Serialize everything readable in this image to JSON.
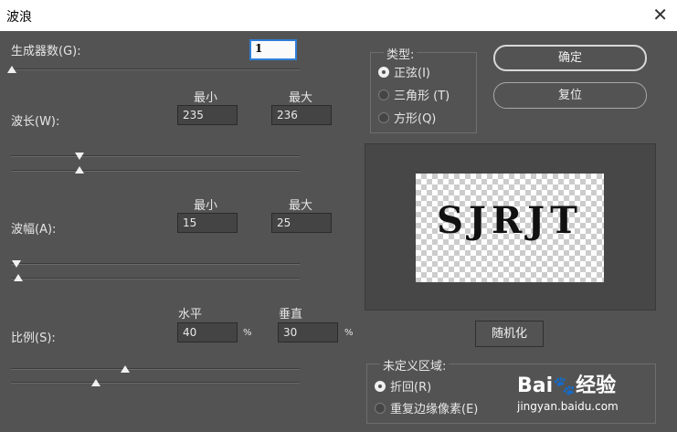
{
  "window": {
    "title": "波浪"
  },
  "generators": {
    "label": "生成器数(G):",
    "value": "1",
    "min": 1,
    "max": 999
  },
  "headers": {
    "min": "最小",
    "max": "最大",
    "horizontal": "水平",
    "vertical": "垂直",
    "percent": "%"
  },
  "wavelength": {
    "label": "波长(W):",
    "min": "235",
    "max": "236"
  },
  "amplitude": {
    "label": "波幅(A):",
    "min": "15",
    "max": "25"
  },
  "scale": {
    "label": "比例(S):",
    "horizontal": "40",
    "vertical": "30"
  },
  "type": {
    "title": "类型:",
    "options": [
      {
        "label": "正弦(I)",
        "selected": true
      },
      {
        "label": "三角形 (T)",
        "selected": false
      },
      {
        "label": "方形(Q)",
        "selected": false
      }
    ]
  },
  "buttons": {
    "ok": "确定",
    "reset": "复位",
    "randomize": "随机化"
  },
  "preview": {
    "text": "SJRJT"
  },
  "undefined_area": {
    "title": "未定义区域:",
    "options": [
      {
        "label": "折回(R)",
        "selected": true
      },
      {
        "label": "重复边缘像素(E)",
        "selected": false
      }
    ]
  },
  "watermark": {
    "brand": "Bai",
    "brand2": "经验",
    "url": "jingyan.baidu.com"
  },
  "colors": {
    "background": "#535353",
    "field": "#444444",
    "focus": "#2f7ed8"
  }
}
